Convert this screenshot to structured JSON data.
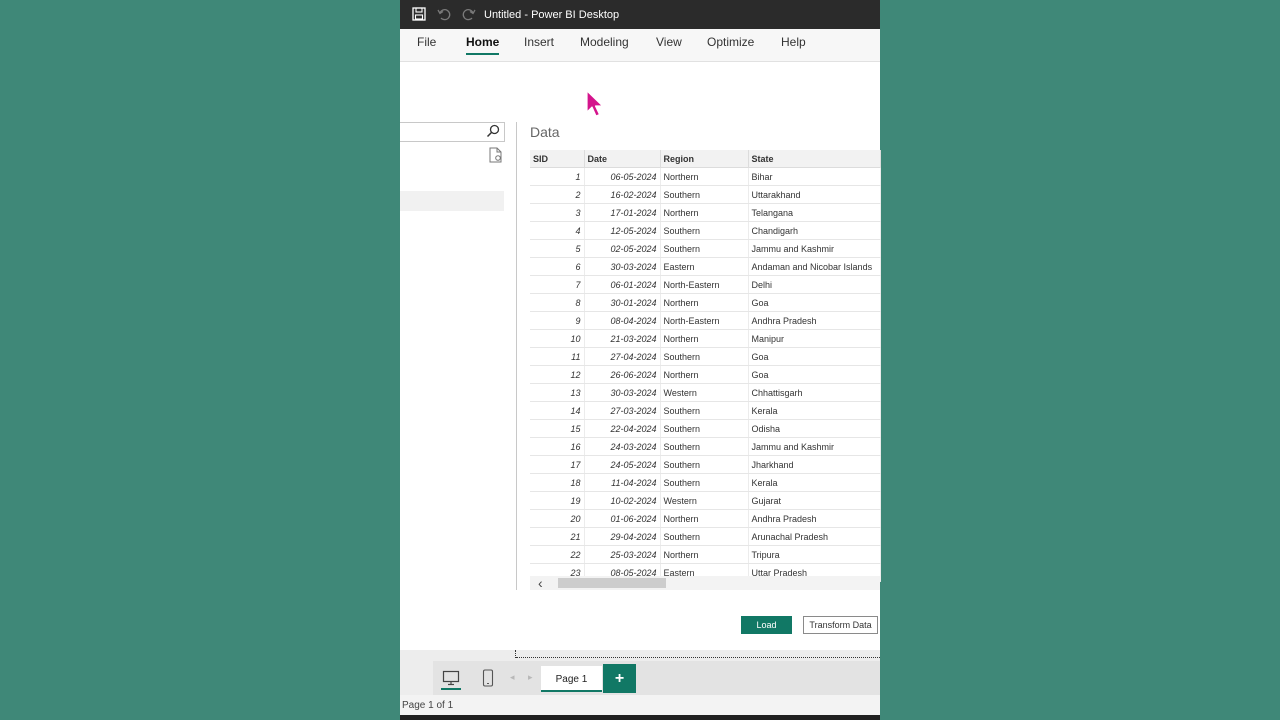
{
  "titlebar": {
    "title": "Untitled - Power BI Desktop",
    "icons": [
      "save-icon",
      "undo-icon",
      "redo-icon"
    ]
  },
  "menu": {
    "items": [
      "File",
      "Home",
      "Insert",
      "Modeling",
      "View",
      "Optimize",
      "Help"
    ],
    "active": "Home"
  },
  "navigator": {
    "preview_title": "Data",
    "columns": [
      "SID",
      "Date",
      "Region",
      "State"
    ],
    "rows": [
      [
        "1",
        "06-05-2024",
        "Northern",
        "Bihar"
      ],
      [
        "2",
        "16-02-2024",
        "Southern",
        "Uttarakhand"
      ],
      [
        "3",
        "17-01-2024",
        "Northern",
        "Telangana"
      ],
      [
        "4",
        "12-05-2024",
        "Southern",
        "Chandigarh"
      ],
      [
        "5",
        "02-05-2024",
        "Southern",
        "Jammu and Kashmir"
      ],
      [
        "6",
        "30-03-2024",
        "Eastern",
        "Andaman and Nicobar Islands"
      ],
      [
        "7",
        "06-01-2024",
        "North-Eastern",
        "Delhi"
      ],
      [
        "8",
        "30-01-2024",
        "Northern",
        "Goa"
      ],
      [
        "9",
        "08-04-2024",
        "North-Eastern",
        "Andhra Pradesh"
      ],
      [
        "10",
        "21-03-2024",
        "Northern",
        "Manipur"
      ],
      [
        "11",
        "27-04-2024",
        "Southern",
        "Goa"
      ],
      [
        "12",
        "26-06-2024",
        "Northern",
        "Goa"
      ],
      [
        "13",
        "30-03-2024",
        "Western",
        "Chhattisgarh"
      ],
      [
        "14",
        "27-03-2024",
        "Southern",
        "Kerala"
      ],
      [
        "15",
        "22-04-2024",
        "Southern",
        "Odisha"
      ],
      [
        "16",
        "24-03-2024",
        "Southern",
        "Jammu and Kashmir"
      ],
      [
        "17",
        "24-05-2024",
        "Southern",
        "Jharkhand"
      ],
      [
        "18",
        "11-04-2024",
        "Southern",
        "Kerala"
      ],
      [
        "19",
        "10-02-2024",
        "Western",
        "Gujarat"
      ],
      [
        "20",
        "01-06-2024",
        "Northern",
        "Andhra Pradesh"
      ],
      [
        "21",
        "29-04-2024",
        "Southern",
        "Arunachal Pradesh"
      ],
      [
        "22",
        "25-03-2024",
        "Northern",
        "Tripura"
      ],
      [
        "23",
        "08-05-2024",
        "Eastern",
        "Uttar Pradesh"
      ]
    ],
    "load_label": "Load",
    "transform_label": "Transform Data"
  },
  "pages": {
    "tab_label": "Page 1",
    "add_label": "+"
  },
  "status": {
    "text": "Page 1 of 1"
  },
  "colors": {
    "accent": "#117865",
    "background": "#3f8878",
    "titlebar": "#2b2b2b",
    "cursor": "#d4148c"
  }
}
